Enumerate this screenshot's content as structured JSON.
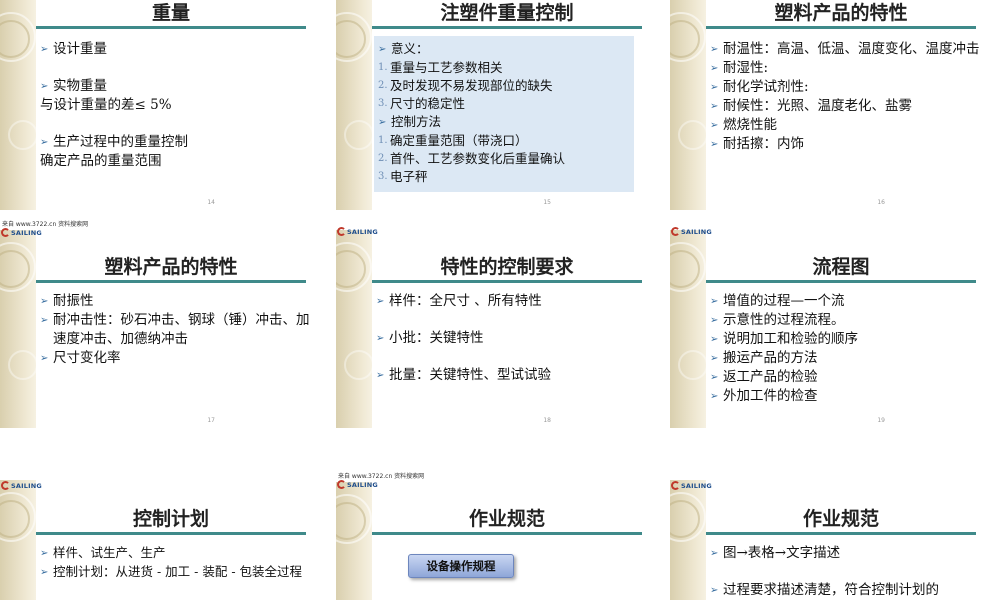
{
  "slides": [
    {
      "title": "重量",
      "page": "14",
      "items": [
        {
          "text": "设计重量",
          "bullet": true
        },
        {
          "gap": true
        },
        {
          "text": "实物重量",
          "bullet": true
        },
        {
          "text": "与设计重量的差≤ 5%",
          "bullet": false
        },
        {
          "gap": true
        },
        {
          "text": "生产过程中的重量控制",
          "bullet": true
        },
        {
          "text": "确定产品的重量范围",
          "bullet": false
        }
      ]
    },
    {
      "title": "注塑件重量控制",
      "page": "15",
      "items": [
        {
          "text": "意义：",
          "bullet": true
        },
        {
          "num": "1.",
          "text": "重量与工艺参数相关"
        },
        {
          "num": "2.",
          "text": "及时发现不易发现部位的缺失"
        },
        {
          "num": "3.",
          "text": "尺寸的稳定性"
        },
        {
          "text": "控制方法",
          "bullet": true
        },
        {
          "num": "1.",
          "text": "确定重量范围（带浇口）"
        },
        {
          "num": "2.",
          "text": "首件、工艺参数变化后重量确认"
        },
        {
          "num": "3.",
          "text": "电子秤"
        }
      ]
    },
    {
      "title": "塑料产品的特性",
      "page": "16",
      "items": [
        {
          "text": "耐温性：高温、低温、温度变化、温度冲击",
          "bullet": true
        },
        {
          "text": "耐湿性:",
          "bullet": true
        },
        {
          "text": "耐化学试剂性:",
          "bullet": true
        },
        {
          "text": "耐候性：光照、温度老化、盐雾",
          "bullet": true
        },
        {
          "text": "燃烧性能",
          "bullet": true
        },
        {
          "text": "耐括擦：内饰",
          "bullet": true
        }
      ]
    },
    {
      "title": "塑料产品的特性",
      "page": "17",
      "items": [
        {
          "text": "耐振性",
          "bullet": true
        },
        {
          "text": "耐冲击性：砂石冲击、钢球（锤）冲击、加速度冲击、加德纳冲击",
          "bullet": true
        },
        {
          "text": "尺寸变化率",
          "bullet": true
        }
      ]
    },
    {
      "title": "特性的控制要求",
      "page": "18",
      "items": [
        {
          "text": "样件：全尺寸 、所有特性",
          "bullet": true
        },
        {
          "gap": true
        },
        {
          "text": "小批：关键特性",
          "bullet": true
        },
        {
          "gap": true
        },
        {
          "text": "批量：关键特性、型试试验",
          "bullet": true
        }
      ]
    },
    {
      "title": "流程图",
      "page": "19",
      "items": [
        {
          "text": "增值的过程—一个流",
          "bullet": true
        },
        {
          "text": "示意性的过程流程。",
          "bullet": true
        },
        {
          "text": "说明加工和检验的顺序",
          "bullet": true
        },
        {
          "text": "搬运产品的方法",
          "bullet": true
        },
        {
          "text": "返工产品的检验",
          "bullet": true
        },
        {
          "text": "外加工件的检查",
          "bullet": true
        }
      ]
    },
    {
      "title": "控制计划",
      "page": "",
      "items": [
        {
          "text": "样件、试生产、生产",
          "bullet": true
        },
        {
          "text": "控制计划：从进货 - 加工 - 装配 - 包装全过程",
          "bullet": true
        }
      ]
    },
    {
      "title": "作业规范",
      "page": "",
      "button": "设备操作规程",
      "items": []
    },
    {
      "title": "作业规范",
      "page": "",
      "items": [
        {
          "text": "图→表格→文字描述",
          "bullet": true
        },
        {
          "gap": true
        },
        {
          "text": "过程要求描述清楚，符合控制计划的",
          "bullet": true
        }
      ]
    }
  ],
  "logo_text": "SAILING",
  "source_text": "来自 www.3722.cn 资料搜索网",
  "colors": {
    "rule": "#3f8a8a",
    "bluebox": "#dce8f4",
    "bullet": "#3a6fa0"
  }
}
